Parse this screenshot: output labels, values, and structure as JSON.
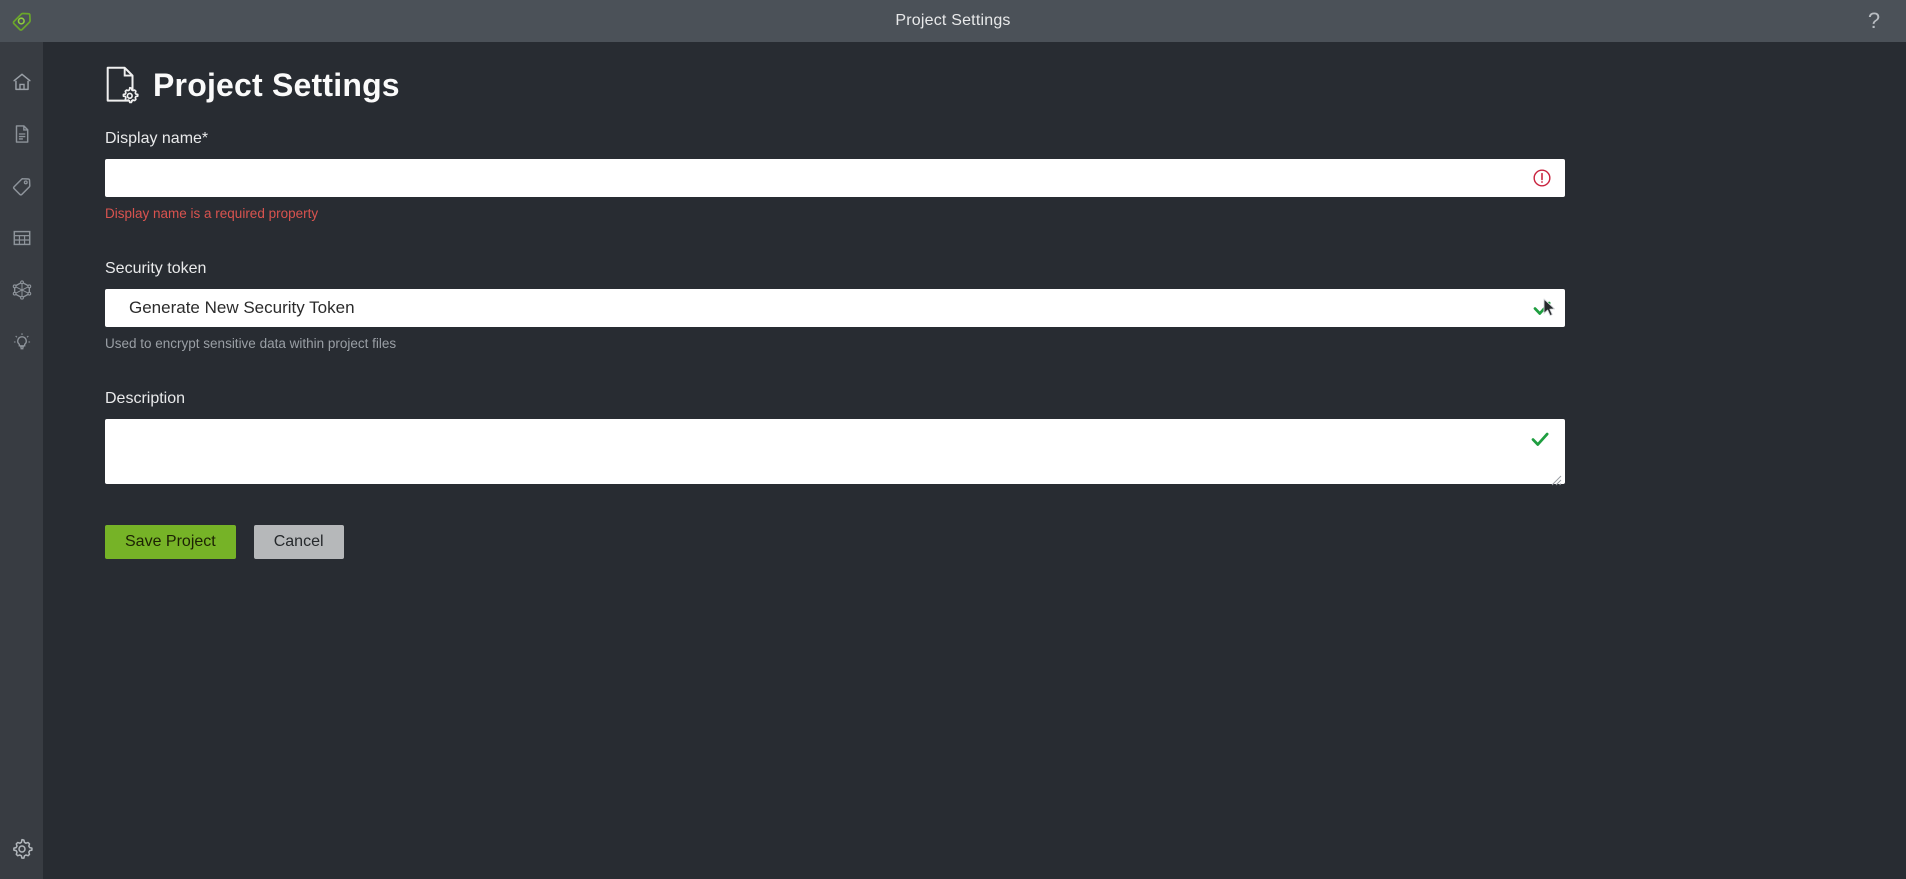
{
  "titlebar": {
    "title": "Project Settings",
    "logo_icon": "tag-logo-icon",
    "help_icon": "help-question-icon",
    "help_label": "?"
  },
  "sidebar": {
    "items": [
      {
        "name": "sidebar-item-home",
        "icon": "home-icon"
      },
      {
        "name": "sidebar-item-documents",
        "icon": "document-icon"
      },
      {
        "name": "sidebar-item-tags",
        "icon": "tag-icon"
      },
      {
        "name": "sidebar-item-table",
        "icon": "table-grid-icon"
      },
      {
        "name": "sidebar-item-model",
        "icon": "network-graph-icon"
      },
      {
        "name": "sidebar-item-insights",
        "icon": "lightbulb-icon"
      }
    ],
    "bottom_item": {
      "name": "sidebar-item-settings",
      "icon": "gear-icon"
    }
  },
  "page": {
    "icon": "document-gear-icon",
    "title": "Project Settings"
  },
  "form": {
    "display_name": {
      "label": "Display name*",
      "value": "",
      "placeholder": "",
      "status_icon": "error-exclamation-icon",
      "error": "Display name is a required property"
    },
    "security_token": {
      "label": "Security token",
      "value": "Generate New Security Token",
      "status_icon": "success-check-icon",
      "help": "Used to encrypt sensitive data within project files"
    },
    "description": {
      "label": "Description",
      "value": "",
      "placeholder": "",
      "status_icon": "success-check-icon"
    }
  },
  "actions": {
    "save_label": "Save Project",
    "cancel_label": "Cancel"
  },
  "colors": {
    "accent_green": "#76b327",
    "error_red": "#d9534f",
    "success_green": "#1f9e40",
    "titlebar_bg": "#4b5158",
    "sidebar_bg": "#383c42",
    "content_bg": "#282c32"
  }
}
